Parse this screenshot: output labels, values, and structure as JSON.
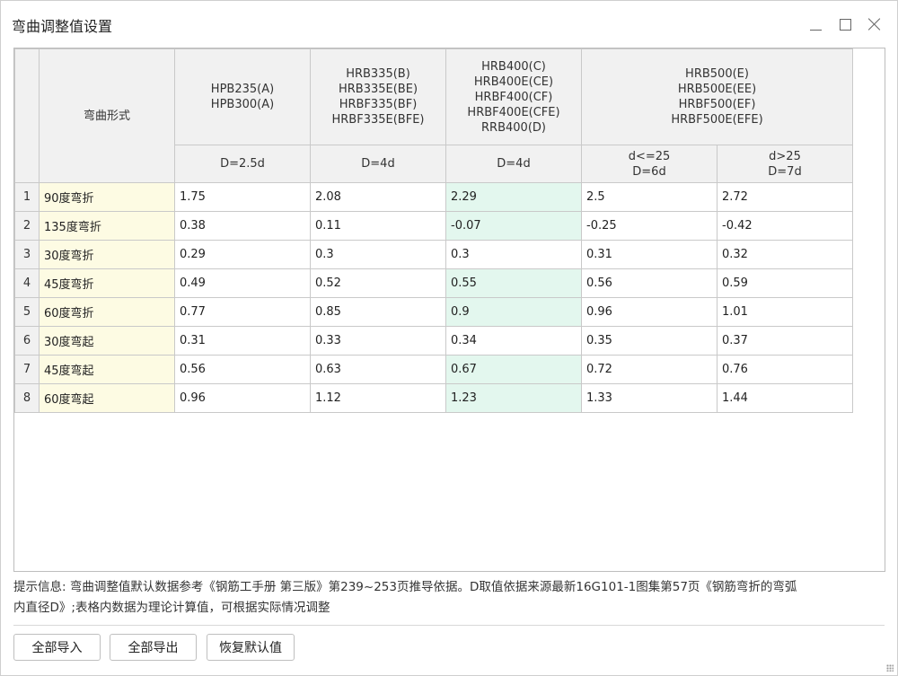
{
  "window": {
    "title": "弯曲调整值设置",
    "controls": [
      "minimize",
      "maximize",
      "close"
    ]
  },
  "table": {
    "headers": {
      "form_label": "弯曲形式",
      "groups": [
        {
          "label": "HPB235(A)\nHPB300(A)"
        },
        {
          "label": "HRB335(B)\nHRB335E(BE)\nHRBF335(BF)\nHRBF335E(BFE)"
        },
        {
          "label": "HRB400(C)\nHRB400E(CE)\nHRBF400(CF)\nHRBF400E(CFE)\nRRB400(D)"
        },
        {
          "label": "HRB500(E)\nHRB500E(EE)\nHRBF500(EF)\nHRBF500E(EFE)"
        }
      ],
      "sub": [
        "D=2.5d",
        "D=4d",
        "D=4d",
        "d<=25\nD=6d",
        "d>25\nD=7d"
      ]
    },
    "rows": [
      {
        "n": "1",
        "form": "90度弯折",
        "v": [
          "1.75",
          "2.08",
          "2.29",
          "2.5",
          "2.72"
        ]
      },
      {
        "n": "2",
        "form": "135度弯折",
        "v": [
          "0.38",
          "0.11",
          "-0.07",
          "-0.25",
          "-0.42"
        ]
      },
      {
        "n": "3",
        "form": "30度弯折",
        "v": [
          "0.29",
          "0.3",
          "0.3",
          "0.31",
          "0.32"
        ]
      },
      {
        "n": "4",
        "form": "45度弯折",
        "v": [
          "0.49",
          "0.52",
          "0.55",
          "0.56",
          "0.59"
        ]
      },
      {
        "n": "5",
        "form": "60度弯折",
        "v": [
          "0.77",
          "0.85",
          "0.9",
          "0.96",
          "1.01"
        ]
      },
      {
        "n": "6",
        "form": "30度弯起",
        "v": [
          "0.31",
          "0.33",
          "0.34",
          "0.35",
          "0.37"
        ]
      },
      {
        "n": "7",
        "form": "45度弯起",
        "v": [
          "0.56",
          "0.63",
          "0.67",
          "0.72",
          "0.76"
        ]
      },
      {
        "n": "8",
        "form": "60度弯起",
        "v": [
          "0.96",
          "1.12",
          "1.23",
          "1.33",
          "1.44"
        ]
      }
    ],
    "highlight_rows": [
      "1",
      "2",
      "4",
      "5",
      "7",
      "8"
    ],
    "colors": {
      "form_cell": "#fdfbe3",
      "highlight_cell": "#e3f7ee",
      "header_bg": "#f1f1f1"
    }
  },
  "hint": {
    "line1": "提示信息: 弯曲调整值默认数据参考《钢筋工手册 第三版》第239~253页推导依据。D取值依据来源最新16G101-1图集第57页《钢筋弯折的弯弧",
    "line2": "内直径D》;表格内数据为理论计算值，可根据实际情况调整"
  },
  "buttons": {
    "import_all": "全部导入",
    "export_all": "全部导出",
    "restore_default": "恢复默认值"
  }
}
